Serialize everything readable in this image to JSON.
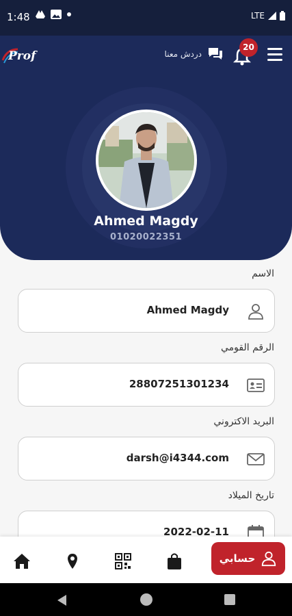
{
  "status_bar": {
    "time": "1:48",
    "network": "LTE"
  },
  "header": {
    "logo_text": "Prof",
    "chat_label": "دردش معنا",
    "notification_count": "20"
  },
  "profile": {
    "name": "Ahmed Magdy",
    "phone": "01020022351"
  },
  "fields": [
    {
      "label": "الاسم",
      "value": "Ahmed Magdy",
      "icon": "user-icon"
    },
    {
      "label": "الرقم القومي",
      "value": "28807251301234",
      "icon": "id-card-icon"
    },
    {
      "label": "البريد الاكتروني",
      "value": "darsh@i4344.com",
      "icon": "mail-icon"
    },
    {
      "label": "تاريخ الميلاد",
      "value": "2022-02-11",
      "icon": "calendar-icon"
    }
  ],
  "bottom_nav": {
    "account_label": "حسابي",
    "items": [
      "home-icon",
      "location-icon",
      "qr-icon",
      "bag-icon"
    ]
  },
  "colors": {
    "primary": "#1c2a5a",
    "accent": "#c0232b"
  }
}
